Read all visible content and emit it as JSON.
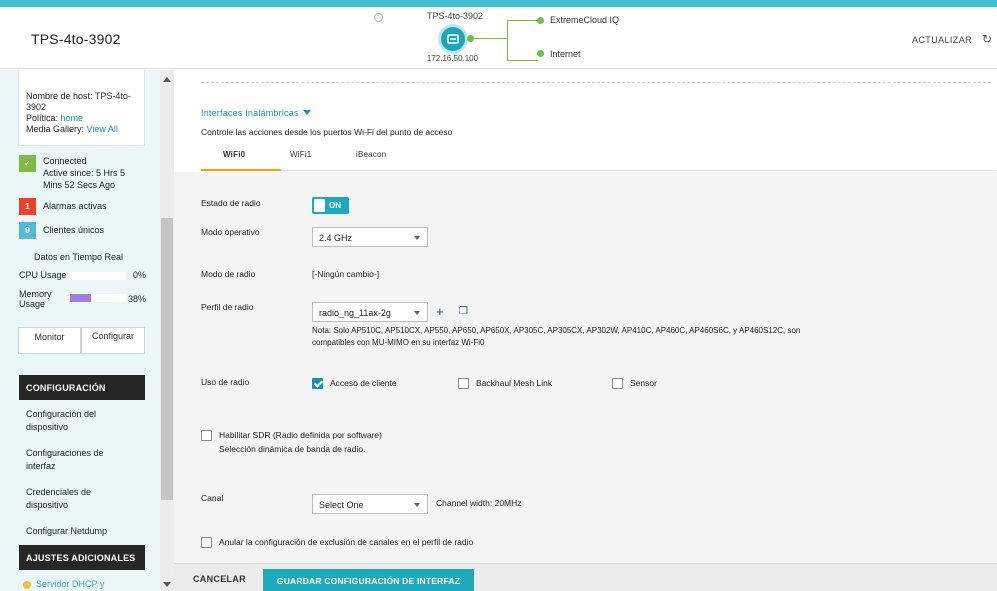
{
  "header": {
    "device_title": "TPS-4to-3902",
    "topology": {
      "device_name": "TPS-4to-3902",
      "device_ip": "172.16.50.100",
      "links": [
        "ExtremeCloud IQ",
        "Internet"
      ]
    },
    "refresh_label": "ACTUALIZAR"
  },
  "sidebar": {
    "host": {
      "hostname_label": "Nombre de host:",
      "hostname_value": "TPS-4to-3902",
      "policy_label": "Política:",
      "policy_value": "home",
      "media_label": "Media Gallery:",
      "media_value": "View All"
    },
    "status": {
      "connected_title": "Connected",
      "connected_since": "Active since: 5 Hrs 5 Mins 52 Secs Ago",
      "alarms_count": "1",
      "alarms_label": "Alarmas activas",
      "clients_count": "0",
      "clients_label": "Clientes únicos"
    },
    "realtime_title": "Datos en Tiempo Real",
    "cpu_label": "CPU Usage",
    "cpu_value": "0%",
    "cpu_fraction": 0.0,
    "memory_label": "Memory Usage",
    "memory_value": "38%",
    "memory_fraction": 0.38,
    "tabs": [
      "Monitor",
      "Configurar"
    ],
    "config_heading": "CONFIGURACIÓN",
    "config_items": [
      "Configuración del dispositivo",
      "Configuraciones de interfaz",
      "Credenciales de dispositivo",
      "Configurar Netdump"
    ],
    "additional_heading": "AJUSTES ADICIONALES",
    "additional_items": [
      "Servidor DHCP y"
    ]
  },
  "main": {
    "section_title": "Interfaces Inalámbricas",
    "section_desc": "Controle las acciones desde los puertos Wi-Fi del punto de acceso",
    "radio_tabs": [
      "WiFi0",
      "WiFi1",
      "iBeacon"
    ],
    "radio_state_label": "Estado de radio",
    "radio_state_value": "ON",
    "mode_label": "Modo operativo",
    "mode_value": "2.4 GHz",
    "radio_mode_label": "Modo de radio",
    "radio_mode_value": "[-Ningún cambio-]",
    "profile_label": "Perfil de radio",
    "profile_value": "radio_ng_11ax-2g",
    "profile_note": "Nota: Solo AP510C, AP510CX, AP550, AP650, AP650X, AP305C, AP305CX, AP302W, AP410C, AP460C, AP460S6C, y AP460S12C, son compatibles con MU-MIMO en su interfaz Wi-Fi0",
    "usage_label": "Uso de radio",
    "usage_options": [
      {
        "label": "Acceso de cliente",
        "checked": true
      },
      {
        "label": "Backhaul Mesh Link",
        "checked": false
      },
      {
        "label": "Sensor",
        "checked": false
      }
    ],
    "sdr_label": "Habilitar SDR (Radio definida por software)",
    "sdr_desc": "Selección dinámica de banda de radio.",
    "channel_label": "Canal",
    "channel_value": "Select One",
    "channel_width": "Channel width: 20MHz",
    "override_label": "Anular la configuración de exclusión de canales en el perfil de radio"
  },
  "footer": {
    "cancel_label": "CANCELAR",
    "save_label": "GUARDAR CONFIGURACIÓN DE INTERFAZ"
  },
  "colors": {
    "accent": "#1ea9bd",
    "link": "#1c8db4",
    "connected": "#7cbb45",
    "alarm": "#e8412c",
    "clients": "#55b9d3",
    "memory_bar": "#a07fd4",
    "tab_underline": "#f0a010"
  }
}
